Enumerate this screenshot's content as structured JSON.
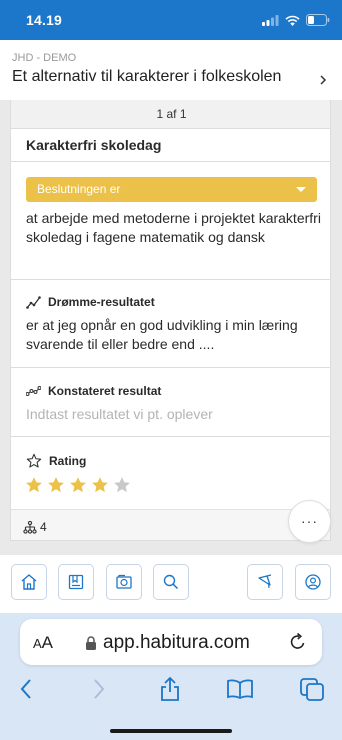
{
  "status_bar": {
    "time": "14.19"
  },
  "header": {
    "breadcrumb": "JHD - DEMO",
    "title": "Et alternativ til karakterer i folkeskolen"
  },
  "card": {
    "pager": "1 af 1",
    "title": "Karakterfri skoledag",
    "decision": {
      "label": "Beslutningen er",
      "color": "#ecc14a",
      "text": "at arbejde med metoderne i projektet karakterfri skoledag i fagene matematik og dansk"
    },
    "dream_result": {
      "heading": "Drømme-resultatet",
      "icon": "line-chart-icon",
      "text": "er at jeg opnår en god udvikling i min læring svarende til eller bedre end ...."
    },
    "observed_result": {
      "heading": "Konstateret resultat",
      "icon": "scatter-chart-icon",
      "placeholder": "Indtast resultatet vi pt. oplever"
    },
    "rating": {
      "heading": "Rating",
      "icon": "star-outline-icon",
      "value": 4,
      "max": 5,
      "filled_color": "#ecc14a",
      "empty_color": "#c9c9c9"
    },
    "footer": {
      "hierarchy_count": "4",
      "icon": "hierarchy-icon"
    },
    "more_label": "···"
  },
  "toolbar": {
    "items": [
      "home-icon",
      "bookmarks-icon",
      "gallery-icon",
      "search-icon",
      "trophy-icon",
      "user-icon"
    ]
  },
  "browser": {
    "aa_label": "AA",
    "url": "app.habitura.com"
  },
  "colors": {
    "status_bar": "#1c76c9",
    "toolbar_border": "#c7d4e6",
    "icon_blue": "#1c76c9"
  }
}
